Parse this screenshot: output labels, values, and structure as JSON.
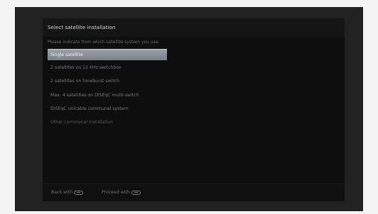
{
  "screen": {
    "title": "Select satellite installation",
    "subtitle": "Please indicate from which satellite system you use."
  },
  "menu": {
    "selected_index": 0,
    "items": [
      {
        "label": "Single satellite"
      },
      {
        "label": "2 satellites on 22 kHz switchbox"
      },
      {
        "label": "2 satellites on toneburst switch"
      },
      {
        "label": "Max. 4 satellites on DiSEqC multi-switch"
      },
      {
        "label": "DiSEqC unicable communal system"
      },
      {
        "label": "Other communal installation"
      }
    ]
  },
  "footer": {
    "back_label": "Back with",
    "back_icon": "back-key-icon",
    "proceed_label": "Proceed with",
    "proceed_icon": "ok-key-icon"
  },
  "colors": {
    "highlight": "#8a9097",
    "panel": "#0e0e0f",
    "frame": "#222222",
    "text_active": "#f4f4f4",
    "text_inactive": "#7a7a7a"
  }
}
